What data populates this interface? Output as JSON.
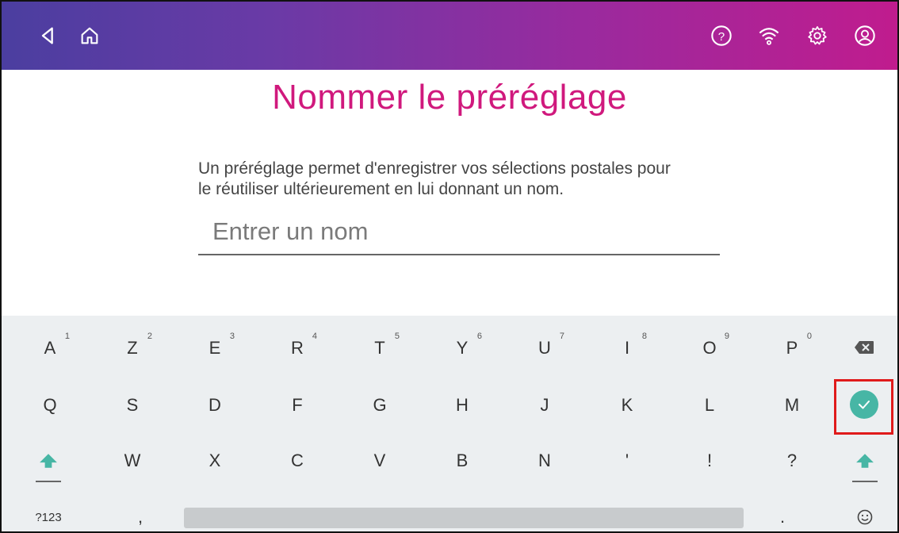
{
  "topbar": {
    "icons": [
      "back-icon",
      "home-icon",
      "help-icon",
      "wifi-icon",
      "settings-icon",
      "account-icon"
    ],
    "gradient_start": "#4b3ea0",
    "gradient_end": "#c01c8e"
  },
  "page": {
    "title": "Nommer le préréglage",
    "description_line1": "Un préréglage permet d'enregistrer vos sélections postales pour",
    "description_line2": "le réutiliser ultérieurement en lui donnant un nom.",
    "title_color": "#d0197d"
  },
  "name_field": {
    "placeholder": "Entrer un nom",
    "value": ""
  },
  "keyboard": {
    "row1": [
      {
        "label": "A",
        "hint": "1"
      },
      {
        "label": "Z",
        "hint": "2"
      },
      {
        "label": "E",
        "hint": "3"
      },
      {
        "label": "R",
        "hint": "4"
      },
      {
        "label": "T",
        "hint": "5"
      },
      {
        "label": "Y",
        "hint": "6"
      },
      {
        "label": "U",
        "hint": "7"
      },
      {
        "label": "I",
        "hint": "8"
      },
      {
        "label": "O",
        "hint": "9"
      },
      {
        "label": "P",
        "hint": "0"
      }
    ],
    "row2": [
      "Q",
      "S",
      "D",
      "F",
      "G",
      "H",
      "J",
      "K",
      "L",
      "M"
    ],
    "row3": [
      "W",
      "X",
      "C",
      "V",
      "B",
      "N",
      "'",
      "!",
      "?"
    ],
    "symbols_label": "?123",
    "comma_label": ",",
    "period_label": ".",
    "backspace_icon": "backspace-icon",
    "ok_icon": "check-icon",
    "shift_icon": "shift-icon",
    "emoji_icon": "emoji-icon",
    "accent_color": "#47b6a5",
    "highlight_color": "#e01b1b"
  }
}
